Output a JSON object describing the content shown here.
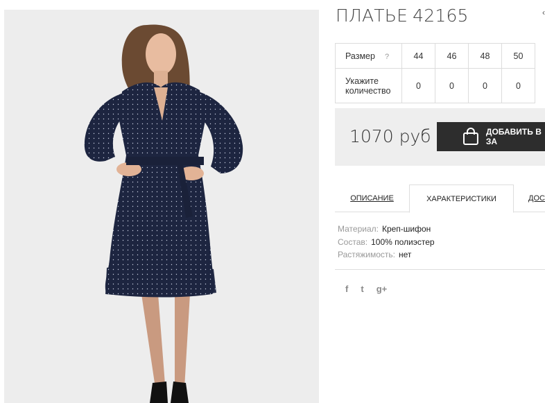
{
  "product": {
    "title": "ПЛАТЬЕ",
    "sku": "42165",
    "image_alt": "Dark navy polka-dot wrap dress worn by model"
  },
  "size_table": {
    "size_label": "Размер",
    "size_help": "?",
    "sizes": [
      "44",
      "46",
      "48",
      "50"
    ],
    "qty_label_line1": "Укажите",
    "qty_label_line2": "количество",
    "quantities": [
      "0",
      "0",
      "0",
      "0"
    ]
  },
  "buy": {
    "price": "1070 руб",
    "add_label": "ДОБАВИТЬ В ЗА"
  },
  "tabs": [
    {
      "label": "ОПИСАНИЕ"
    },
    {
      "label": "ХАРАКТЕРИСТИКИ"
    },
    {
      "label": "ДОСТ"
    }
  ],
  "specs": [
    {
      "key": "Материал:",
      "value": "Креп-шифон"
    },
    {
      "key": "Состав:",
      "value": "100% полиэстер"
    },
    {
      "key": "Растяжимость:",
      "value": "нет"
    }
  ],
  "social": {
    "facebook": "f",
    "twitter": "t",
    "googleplus": "g+"
  },
  "colors": {
    "dress": "#1d2540",
    "button": "#2d2d2d",
    "buybar_bg": "#eeeeee",
    "photo_bg": "#ededed"
  }
}
